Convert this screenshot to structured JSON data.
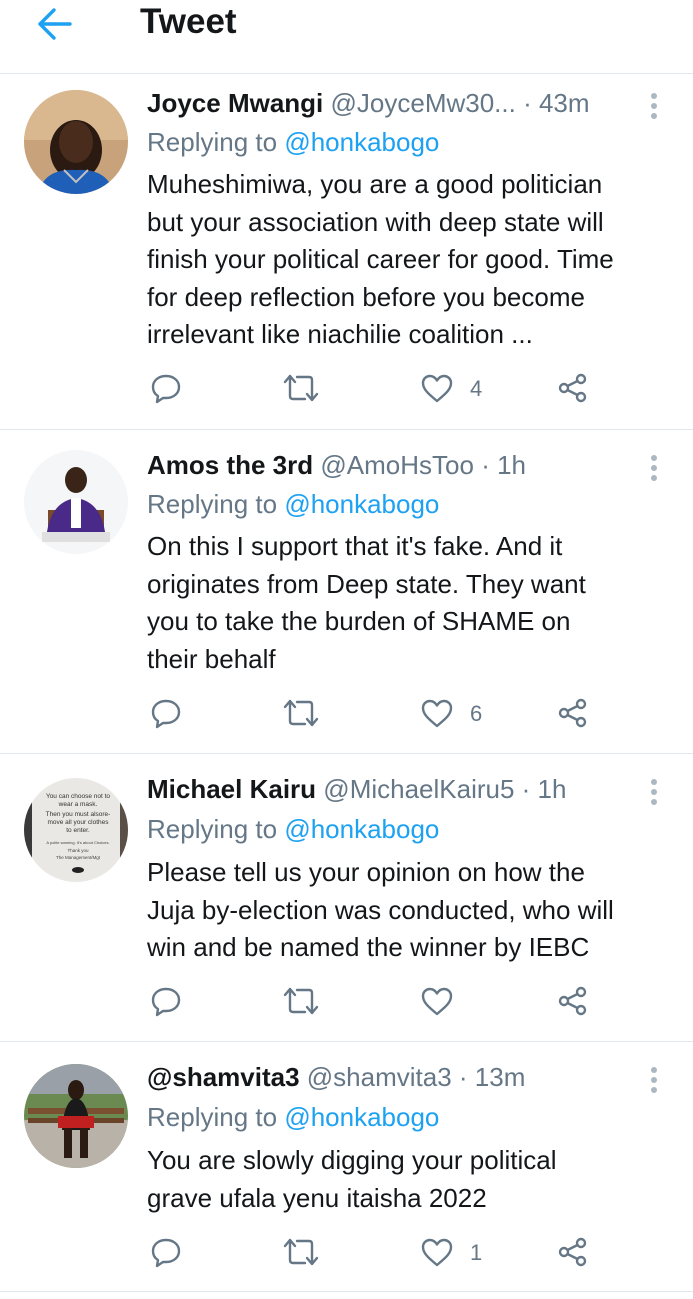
{
  "header": {
    "title": "Tweet"
  },
  "tweets": [
    {
      "name": "Joyce Mwangi",
      "handle": "@JoyceMw30...",
      "time": "· 43m",
      "replying_prefix": "Replying to",
      "replying_to": "@honkabogo",
      "lines": [
        "Muheshimiwa, you are a good politician",
        "but your association with deep state will",
        "finish your political career for good. Time",
        "for deep reflection before you become",
        "irrelevant like niachilie coalition ..."
      ],
      "likes": "4"
    },
    {
      "name": "Amos the 3rd",
      "handle": "@AmoHsToo",
      "time": "· 1h",
      "replying_prefix": "Replying to",
      "replying_to": "@honkabogo",
      "lines": [
        "On this I support that it's fake. And it",
        "originates from Deep state. They want",
        "you to take the burden of SHAME on",
        "their behalf"
      ],
      "likes": "6"
    },
    {
      "name": "Michael Kairu",
      "handle": "@MichaelKairu5",
      "time": "· 1h",
      "replying_prefix": "Replying to",
      "replying_to": "@honkabogo",
      "lines": [
        "Please tell us your opinion on how the",
        "Juja by-election was conducted, who will",
        "win and be named the winner by IEBC"
      ],
      "likes": "",
      "avatar_text": [
        "You can choose not to",
        "wear a mask.",
        "Then you must alsore-",
        "move all your clothes",
        "to enter.",
        "A polite warning. It's about Choices.",
        "Thank you",
        "The Management/Mgt"
      ]
    },
    {
      "name": "@shamvita3",
      "handle": "@shamvita3",
      "time": "· 13m",
      "replying_prefix": "Replying to",
      "replying_to": "@honkabogo",
      "lines": [
        "You are slowly digging your political",
        "grave ufala yenu itaisha 2022"
      ],
      "likes": "1"
    }
  ],
  "icons": {
    "back": "back-arrow-icon",
    "reply": "reply-icon",
    "retweet": "retweet-icon",
    "like": "heart-icon",
    "share": "share-icon",
    "more": "more-vertical-icon"
  },
  "colors": {
    "accent": "#1da1f2",
    "text": "#14171a",
    "secondary": "#657786",
    "divider": "#e1e8ed"
  }
}
